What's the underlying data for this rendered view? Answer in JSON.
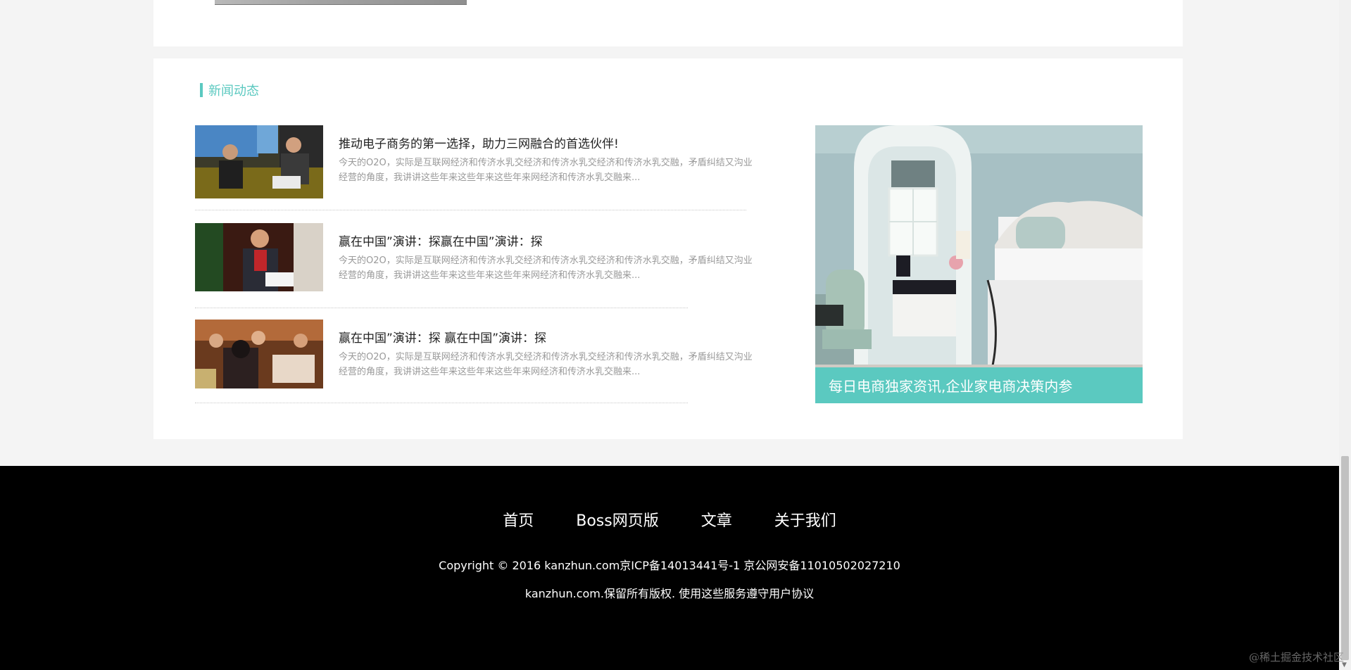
{
  "news_section": {
    "title": "新闻动态",
    "items": [
      {
        "headline": "推动电子商务的第一选择，助力三网融合的首选伙伴!",
        "excerpt": "今天的O2O，实际是互联网经济和传济水乳交经济和传济水乳交经济和传济水乳交融，矛盾纠结又沟业经营的角度，我讲讲这些年来这些年来这些年来网经济和传济水乳交融来..."
      },
      {
        "headline": "赢在中国”演讲：探赢在中国”演讲：探",
        "excerpt": "今天的O2O，实际是互联网经济和传济水乳交经济和传济水乳交经济和传济水乳交融，矛盾纠结又沟业经营的角度，我讲讲这些年来这些年来这些年来网经济和传济水乳交融来..."
      },
      {
        "headline": "赢在中国”演讲：探 赢在中国”演讲：探",
        "excerpt": "今天的O2O，实际是互联网经济和传济水乳交经济和传济水乳交经济和传济水乳交融，矛盾纠结又沟业经营的角度，我讲讲这些年来这些年来这些年来网经济和传济水乳交融来..."
      }
    ],
    "feature_caption": "每日电商独家资讯,企业家电商决策内参"
  },
  "footer": {
    "nav": [
      "首页",
      "Boss网页版",
      "文章",
      "关于我们"
    ],
    "copyright": "Copyright © 2016 kanzhun.com京ICP备14013441号-1 京公网安备11010502027210",
    "rights": "kanzhun.com.保留所有版权. 使用这些服务遵守用户协议"
  },
  "watermark": "@稀土掘金技术社区",
  "colors": {
    "accent": "#5bc9c0",
    "footer_bg": "#000000",
    "page_bg": "#f4f4f4"
  }
}
